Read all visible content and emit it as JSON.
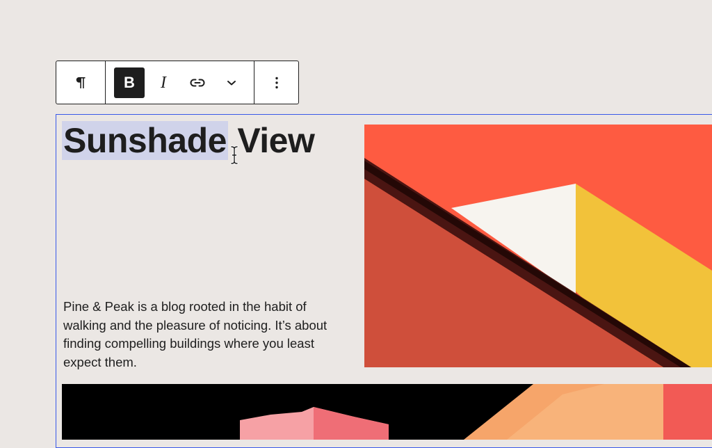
{
  "toolbar": {
    "paragraph": {
      "icon": "paragraph-icon",
      "symbol": "¶"
    },
    "bold": {
      "icon": "bold-icon",
      "label": "B",
      "active": true
    },
    "italic": {
      "icon": "italic-icon",
      "label": "I"
    },
    "link": {
      "icon": "link-icon"
    },
    "more_rich_text": {
      "icon": "chevron-down-icon"
    },
    "options": {
      "icon": "more-vertical-icon"
    }
  },
  "block": {
    "selected": true,
    "heading": {
      "selected_text": "Sunshade",
      "rest_text": " View"
    },
    "description": "Pine & Peak is a blog rooted in the habit of walking and the pleasure of noticing. It’s about finding compelling buildings where you least expect them."
  },
  "colors": {
    "background": "#ebe7e4",
    "selection_outline": "#3858e9",
    "text_selection": "#d0d3ea",
    "toolbar_active": "#1e1e1e",
    "image_sky": "#fe5b41",
    "image_wall_red": "#cf4f3b",
    "image_wall_yellow": "#f2c23a",
    "image_wall_white": "#f7f4ef"
  }
}
